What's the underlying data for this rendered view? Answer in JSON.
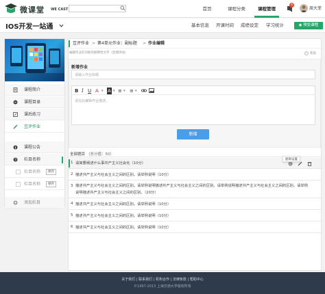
{
  "app": {
    "brand_cn": "微课堂",
    "brand_en": "WE CAST"
  },
  "topnav": {
    "items": [
      {
        "label": "首页"
      },
      {
        "label": "课程分类"
      },
      {
        "label": "课程管理"
      }
    ],
    "active_index": 2,
    "notification_count": "4",
    "username": "周大菲"
  },
  "course": {
    "title": "IOS开发一站通",
    "tabs": [
      {
        "label": "基本信息"
      },
      {
        "label": "开课时间"
      },
      {
        "label": "成绩设定"
      },
      {
        "label": "学习统计"
      }
    ],
    "preview_button": "预览课程"
  },
  "sidebar": {
    "items": [
      {
        "label": "课程简介",
        "icon": "document-icon"
      },
      {
        "label": "课程目录",
        "icon": "list-icon"
      },
      {
        "label": "课后练习",
        "icon": "edit-icon"
      },
      {
        "label": "互评作业",
        "icon": "pen-icon",
        "active": true
      }
    ],
    "section": {
      "label": "课程公告",
      "icon": "info-icon"
    },
    "column": {
      "label": "栏目名称",
      "icon": "help-icon"
    },
    "sub_items": [
      {
        "label": "栏目名称",
        "save": "保存"
      },
      {
        "label": "栏目名称",
        "save": "保存"
      }
    ],
    "add_label": "添加栏目"
  },
  "breadcrumb": {
    "items": [
      "互评作业",
      "第4单元作业：副标题",
      "作业编辑"
    ],
    "separator": ">",
    "hint": "编辑作业的功能的解释性文字（后期添加）",
    "help": "帮助"
  },
  "editor": {
    "panel_title": "新增作业",
    "title_placeholder": "请输入作业标题",
    "body_placeholder": "请在此编辑作业描述。",
    "add_button": "新增",
    "toolbar": [
      "B",
      "I",
      "U",
      "A",
      "A",
      "≡",
      "≡",
      "link",
      "image"
    ]
  },
  "questions": {
    "header_label": "全部题目",
    "header_count": "（总分值：50）",
    "tooltip": "题目设置",
    "items": [
      {
        "num": "1",
        "text": "请简要阐述什么事共产主义社会化（10分）"
      },
      {
        "num": "2",
        "text": "描述共产主义与社会主义之间的区别。请举例说明（10分）"
      },
      {
        "num": "3",
        "text": "描述共产主义与社会主义之间的区别。请举例说明描述共产主义与社会主义之间的区别。请举例说明描述共产主义与社会主义之间的区别。请举例说明描述共产主义与社会主义之间的区别。（20分）"
      },
      {
        "num": "4",
        "text": "描述共产主义与社会主义之间的区别。请举例说明（10分）"
      },
      {
        "num": "5",
        "text": "描述共产主义与社会主义之间的区别。请举例说明（10分）"
      },
      {
        "num": "6",
        "text": "描述共产主义与社会主义之间的区别。请举例说明（10分）"
      }
    ]
  },
  "footer": {
    "links": "关于我们 | 联系我们 | 机构合作 | 法律条款 | 帮助中心",
    "copyright": "©1997-2013 上海交通大学版权所有"
  },
  "colors": {
    "accent": "#27a66a",
    "primary_button": "#4a9de8",
    "footer_bg": "#2f3a4a",
    "badge": "#e34b2e"
  }
}
